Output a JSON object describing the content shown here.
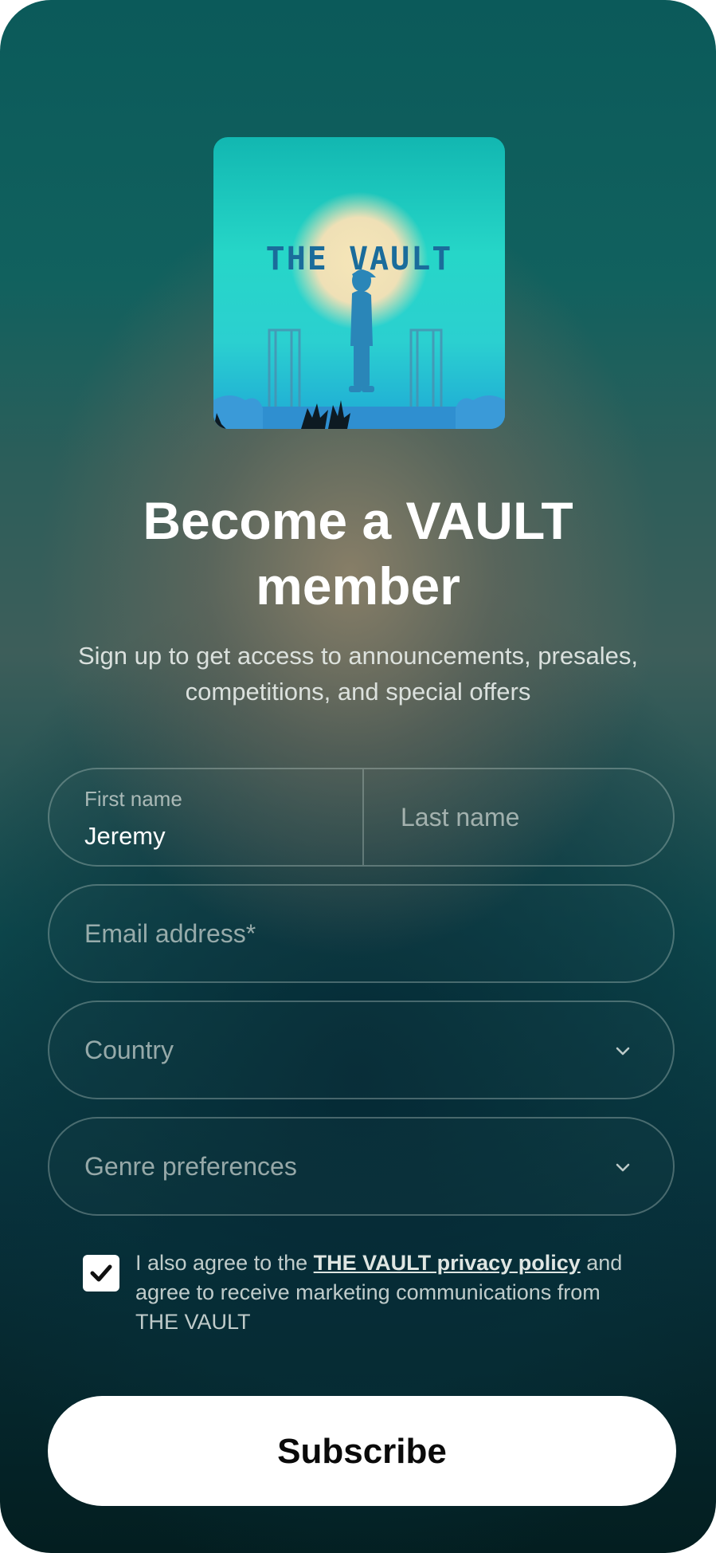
{
  "cover": {
    "title": "THE VAULT"
  },
  "header": {
    "title": "Become a VAULT member",
    "subtitle": "Sign up to get access to announcements, presales, competitions, and special offers"
  },
  "form": {
    "first_name": {
      "label": "First name",
      "value": "Jeremy"
    },
    "last_name": {
      "placeholder": "Last name"
    },
    "email": {
      "placeholder": "Email address*"
    },
    "country": {
      "placeholder": "Country"
    },
    "genre": {
      "placeholder": "Genre preferences"
    },
    "consent": {
      "checked": true,
      "text_before": "I also agree to the ",
      "link_text": "THE VAULT privacy policy",
      "text_after": " and agree to receive marketing communications from THE VAULT"
    },
    "submit_label": "Subscribe"
  },
  "colors": {
    "accent": "#ffffff",
    "cover_title": "#1a6c9b",
    "background_top": "#0b5a5a",
    "background_bottom": "#031e20"
  }
}
